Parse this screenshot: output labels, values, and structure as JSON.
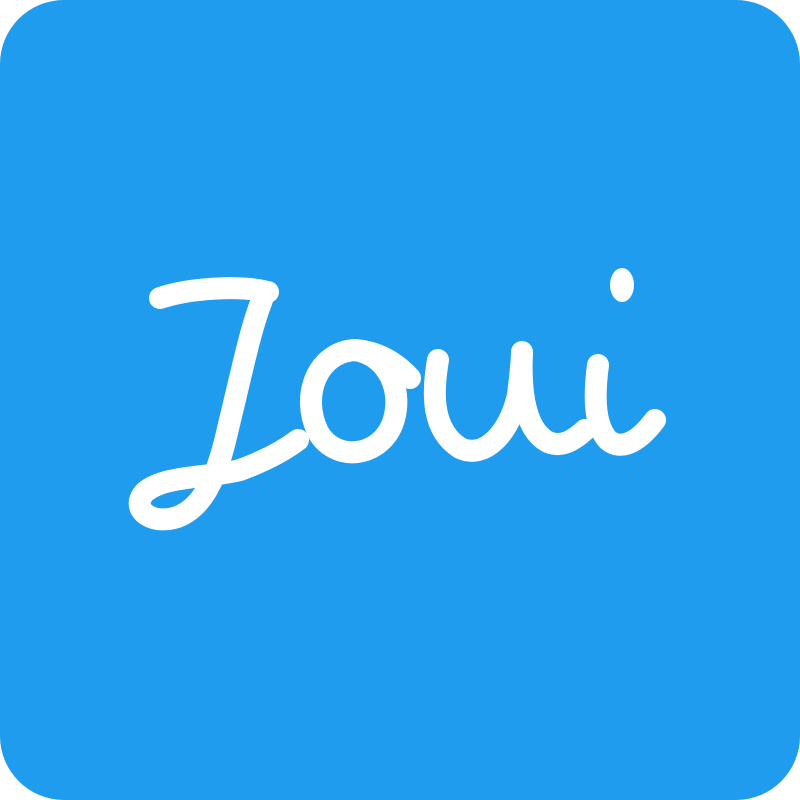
{
  "icon": {
    "logo_text": "Joui",
    "background_color": "#209CEE",
    "glyph_color": "#FFFFFF",
    "style": "pixelated handwritten script logo"
  }
}
